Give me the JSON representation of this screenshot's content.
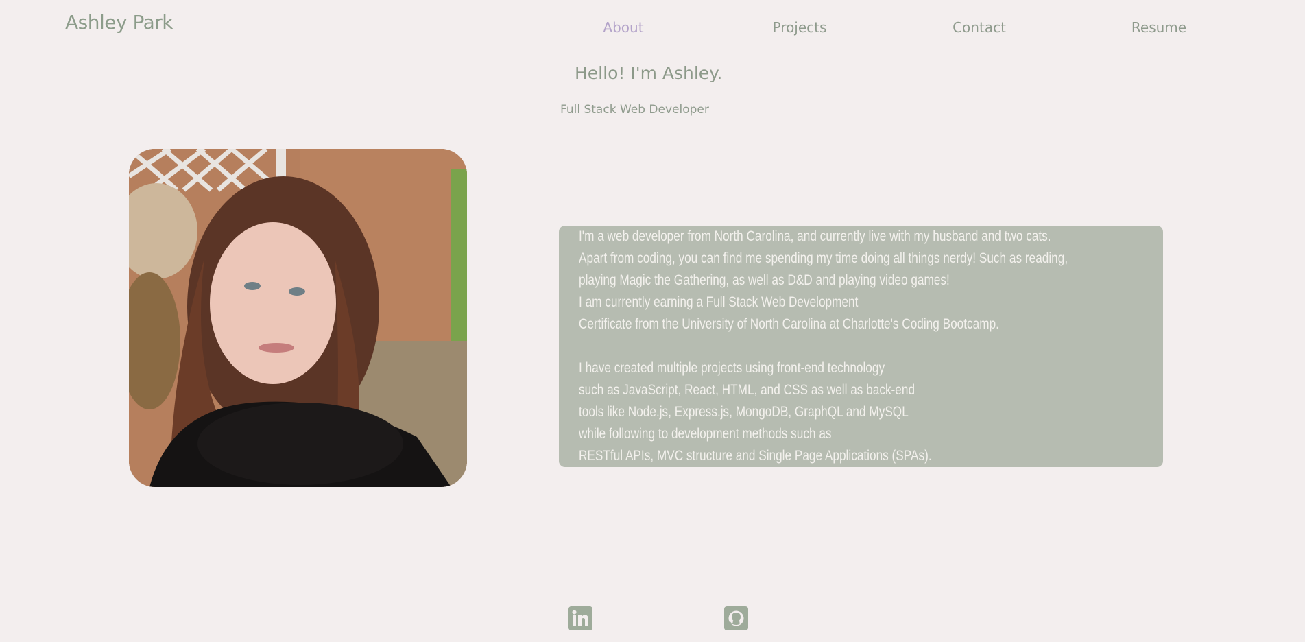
{
  "header": {
    "brand": "Ashley Park",
    "nav": [
      {
        "label": "About",
        "active": true
      },
      {
        "label": "Projects",
        "active": false
      },
      {
        "label": "Contact",
        "active": false
      },
      {
        "label": "Resume",
        "active": false
      }
    ]
  },
  "hero": {
    "greeting": "Hello! I'm Ashley.",
    "role": "Full Stack Web Developer"
  },
  "bio": {
    "paragraph1": [
      "I'm a web developer from North Carolina, and currently live with my husband and two cats.",
      "Apart from coding, you can find me spending my time doing all things nerdy! Such as reading,",
      "playing Magic the Gathering, as well as D&D and playing video games!",
      "I am currently earning a Full Stack Web Development",
      "Certificate from the University of North Carolina at Charlotte's Coding Bootcamp."
    ],
    "paragraph2": [
      "I have created multiple projects using front-end technology",
      "such as JavaScript, React, HTML, and CSS as well as back-end",
      "tools like Node.js, Express.js, MongoDB, GraphQL and MySQL",
      "while following to development methods such as",
      "RESTful APIs, MVC structure and Single Page Applications (SPAs)."
    ]
  },
  "footer": {
    "links": [
      {
        "icon": "linkedin-icon"
      },
      {
        "icon": "github-icon"
      }
    ]
  },
  "colors": {
    "background": "#f3eeee",
    "accent_nav_active": "#b3a3c9",
    "text_muted_green": "#8c9c8a",
    "bio_panel": "#b6bcb1",
    "bio_text": "#f3f1ed",
    "social_icon_bg": "#9eab9a"
  }
}
